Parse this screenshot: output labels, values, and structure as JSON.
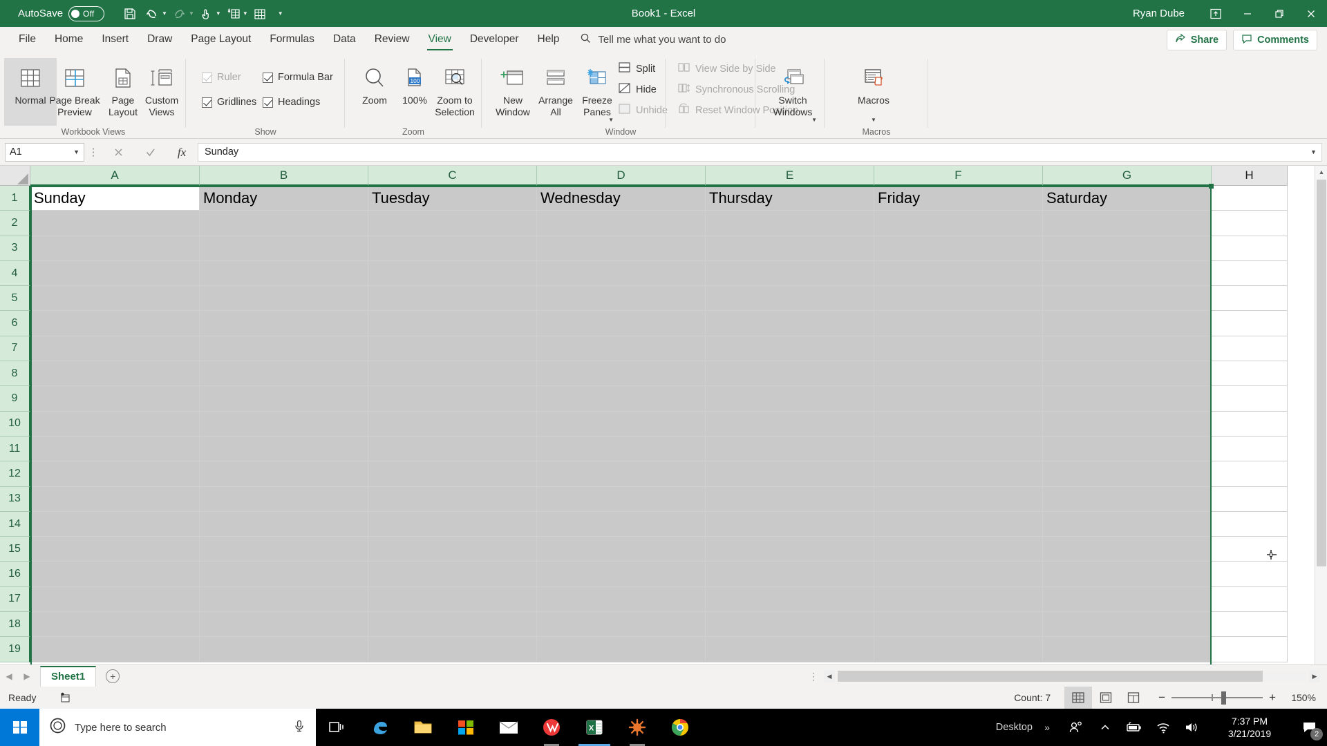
{
  "titlebar": {
    "autosave_label": "AutoSave",
    "autosave_state": "Off",
    "document_title": "Book1  -  Excel",
    "user_name": "Ryan Dube",
    "qat": [
      {
        "name": "save-icon",
        "label": "Save"
      },
      {
        "name": "undo-icon",
        "label": "Undo"
      },
      {
        "name": "redo-icon",
        "label": "Redo"
      },
      {
        "name": "touch-mode-icon",
        "label": "Touch/Mouse Mode"
      },
      {
        "name": "new-table-icon",
        "label": "Insert"
      },
      {
        "name": "customize-qat-icon",
        "label": "Customize Quick Access Toolbar"
      }
    ],
    "window_controls": [
      "ribbon-display-options",
      "minimize",
      "restore",
      "close"
    ],
    "brand_color": "#217346"
  },
  "tabs": [
    {
      "label": "File",
      "active": false
    },
    {
      "label": "Home",
      "active": false
    },
    {
      "label": "Insert",
      "active": false
    },
    {
      "label": "Draw",
      "active": false
    },
    {
      "label": "Page Layout",
      "active": false
    },
    {
      "label": "Formulas",
      "active": false
    },
    {
      "label": "Data",
      "active": false
    },
    {
      "label": "Review",
      "active": false
    },
    {
      "label": "View",
      "active": true
    },
    {
      "label": "Developer",
      "active": false
    },
    {
      "label": "Help",
      "active": false
    }
  ],
  "tellme": {
    "placeholder": "Tell me what you want to do"
  },
  "header_buttons": {
    "share": "Share",
    "comments": "Comments"
  },
  "ribbon": {
    "groups": [
      {
        "label": "Workbook Views"
      },
      {
        "label": "Show"
      },
      {
        "label": "Zoom"
      },
      {
        "label": "Window"
      },
      {
        "label": "Macros"
      }
    ],
    "workbook_views": [
      {
        "label": "Normal",
        "icon": "normal-view-icon",
        "selected": true
      },
      {
        "label": "Page Break\nPreview",
        "icon": "page-break-preview-icon",
        "selected": false
      },
      {
        "label": "Page\nLayout",
        "icon": "page-layout-icon",
        "selected": false
      },
      {
        "label": "Custom\nViews",
        "icon": "custom-views-icon",
        "selected": false
      }
    ],
    "show": [
      {
        "label": "Ruler",
        "checked": true,
        "disabled": true
      },
      {
        "label": "Formula Bar",
        "checked": true,
        "disabled": false
      },
      {
        "label": "Gridlines",
        "checked": true,
        "disabled": false
      },
      {
        "label": "Headings",
        "checked": true,
        "disabled": false
      }
    ],
    "zoom": [
      {
        "label": "Zoom",
        "icon": "zoom-icon"
      },
      {
        "label": "100%",
        "icon": "zoom-100-icon"
      },
      {
        "label": "Zoom to\nSelection",
        "icon": "zoom-to-selection-icon"
      }
    ],
    "window_big": [
      {
        "label": "New\nWindow",
        "icon": "new-window-icon"
      },
      {
        "label": "Arrange\nAll",
        "icon": "arrange-all-icon"
      },
      {
        "label": "Freeze\nPanes",
        "icon": "freeze-panes-icon",
        "has_dropdown": true
      }
    ],
    "window_small_left": [
      {
        "label": "Split",
        "icon": "split-icon",
        "disabled": false
      },
      {
        "label": "Hide",
        "icon": "hide-icon",
        "disabled": false
      },
      {
        "label": "Unhide",
        "icon": "unhide-icon",
        "disabled": true
      }
    ],
    "window_small_right": [
      {
        "label": "View Side by Side",
        "icon": "view-side-by-side-icon",
        "disabled": true
      },
      {
        "label": "Synchronous Scrolling",
        "icon": "synchronous-scrolling-icon",
        "disabled": true
      },
      {
        "label": "Reset Window Position",
        "icon": "reset-window-position-icon",
        "disabled": true
      }
    ],
    "switch_windows": {
      "label": "Switch\nWindows",
      "icon": "switch-windows-icon"
    },
    "macros": {
      "label": "Macros",
      "icon": "macros-icon"
    }
  },
  "formula_bar": {
    "name_box_value": "A1",
    "cancel_icon": "cancel-icon",
    "enter_icon": "enter-icon",
    "function_icon": "insert-function-icon",
    "content": "Sunday",
    "expand_icon": "expand-formula-bar-icon"
  },
  "grid": {
    "columns": [
      "A",
      "B",
      "C",
      "D",
      "E",
      "F",
      "G",
      "H"
    ],
    "rows": [
      "1",
      "2",
      "3",
      "4",
      "5",
      "6",
      "7",
      "8",
      "9",
      "10",
      "11",
      "12",
      "13",
      "14",
      "15",
      "16",
      "17",
      "18",
      "19"
    ],
    "row1_values": [
      "Sunday",
      "Monday",
      "Tuesday",
      "Wednesday",
      "Thursday",
      "Friday",
      "Saturday",
      ""
    ],
    "active_cell": "A1",
    "selection_range": "A:G",
    "selected_columns": [
      "A",
      "B",
      "C",
      "D",
      "E",
      "F",
      "G"
    ]
  },
  "sheetbar": {
    "prev_icon": "previous-sheet-icon",
    "next_icon": "next-sheet-icon",
    "tabs": [
      {
        "label": "Sheet1",
        "active": true
      }
    ],
    "add_label": "+"
  },
  "statusbar": {
    "mode": "Ready",
    "macro_record_icon": "record-macro-icon",
    "count_label": "Count: 7",
    "views": [
      {
        "name": "normal-view-button",
        "selected": true
      },
      {
        "name": "page-layout-view-button",
        "selected": false
      },
      {
        "name": "page-break-preview-button",
        "selected": false
      }
    ],
    "zoom_out": "−",
    "zoom_in": "+",
    "zoom_level": "150%"
  },
  "taskbar": {
    "start_icon": "windows-start-icon",
    "search_placeholder": "Type here to search",
    "search_mic_icon": "microphone-icon",
    "apps": [
      {
        "name": "task-view-icon",
        "running": false,
        "active": false
      },
      {
        "name": "edge-icon",
        "running": false,
        "active": false
      },
      {
        "name": "file-explorer-icon",
        "running": false,
        "active": false
      },
      {
        "name": "microsoft-store-icon",
        "running": false,
        "active": false
      },
      {
        "name": "mail-icon",
        "running": false,
        "active": false
      },
      {
        "name": "vivaldi-icon",
        "running": true,
        "active": false
      },
      {
        "name": "excel-icon",
        "running": false,
        "active": true
      },
      {
        "name": "app-icon",
        "running": true,
        "active": false
      },
      {
        "name": "chrome-icon",
        "running": false,
        "active": false
      }
    ],
    "desktop_label": "Desktop",
    "overflow_icon": "show-hidden-icons-icon",
    "tray": [
      "people-icon",
      "show-hidden-icons-icon",
      "battery-icon",
      "wifi-icon",
      "volume-icon"
    ],
    "time": "7:37 PM",
    "date": "3/21/2019",
    "notification_icon": "action-center-icon",
    "notification_count": "2"
  }
}
